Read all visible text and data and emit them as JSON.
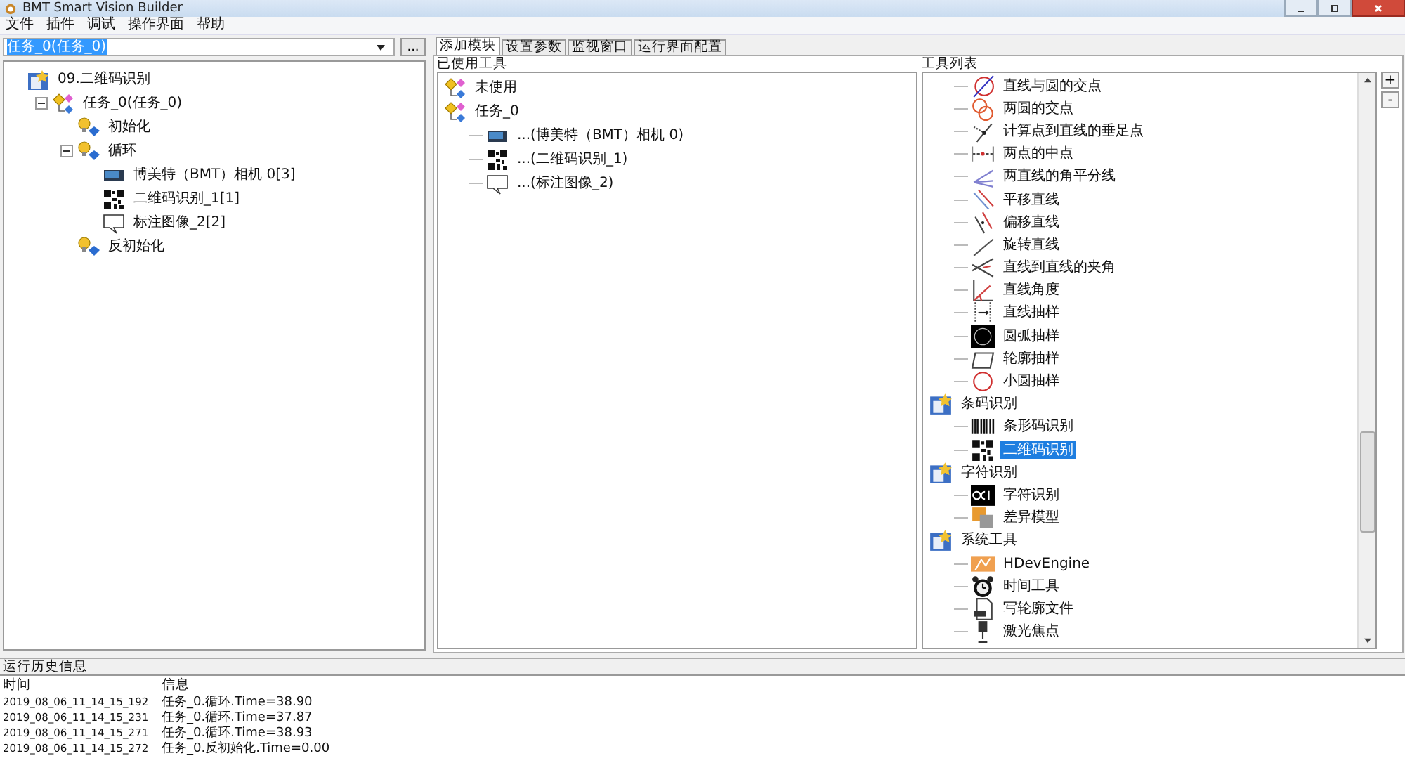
{
  "window": {
    "title": "BMT Smart Vision Builder"
  },
  "menu": [
    "文件",
    "插件",
    "调试",
    "操作界面",
    "帮助"
  ],
  "task_select": {
    "value": "任务_0(任务_0)",
    "button": "..."
  },
  "project_tree": [
    {
      "label": "09.二维码识别",
      "kind": "project",
      "children": [
        {
          "label": "任务_0(任务_0)",
          "kind": "task",
          "expanded": true,
          "children": [
            {
              "label": "初始化",
              "kind": "step"
            },
            {
              "label": "循环",
              "kind": "step",
              "expanded": true,
              "children": [
                {
                  "label": "博美特（BMT）相机 0[3]",
                  "kind": "camera"
                },
                {
                  "label": "二维码识别_1[1]",
                  "kind": "qrcode"
                },
                {
                  "label": "标注图像_2[2]",
                  "kind": "annotation"
                }
              ]
            },
            {
              "label": "反初始化",
              "kind": "step"
            }
          ]
        }
      ]
    }
  ],
  "tabs": [
    {
      "label": "添加模块",
      "selected": true
    },
    {
      "label": "设置参数",
      "selected": false
    },
    {
      "label": "监视窗口",
      "selected": false
    },
    {
      "label": "运行界面配置",
      "selected": false
    }
  ],
  "used_tools": {
    "title": "已使用工具",
    "tree": [
      {
        "label": "未使用",
        "kind": "task"
      },
      {
        "label": "任务_0",
        "kind": "task",
        "children": [
          {
            "label": "...(博美特（BMT）相机 0)",
            "kind": "camera"
          },
          {
            "label": "...(二维码识别_1)",
            "kind": "qrcode"
          },
          {
            "label": "...(标注图像_2)",
            "kind": "annotation"
          }
        ]
      }
    ]
  },
  "tool_list": {
    "title": "工具列表",
    "items": [
      {
        "kind": "tool",
        "label": "直线与圆的交点",
        "selected": false
      },
      {
        "kind": "tool",
        "label": "两圆的交点",
        "selected": false
      },
      {
        "kind": "tool",
        "label": "计算点到直线的垂足点",
        "selected": false
      },
      {
        "kind": "tool",
        "label": "两点的中点",
        "selected": false
      },
      {
        "kind": "tool",
        "label": "两直线的角平分线",
        "selected": false
      },
      {
        "kind": "tool",
        "label": "平移直线",
        "selected": false
      },
      {
        "kind": "tool",
        "label": "偏移直线",
        "selected": false
      },
      {
        "kind": "tool",
        "label": "旋转直线",
        "selected": false
      },
      {
        "kind": "tool",
        "label": "直线到直线的夹角",
        "selected": false
      },
      {
        "kind": "tool",
        "label": "直线角度",
        "selected": false
      },
      {
        "kind": "tool",
        "label": "直线抽样",
        "selected": false
      },
      {
        "kind": "tool",
        "label": "圆弧抽样",
        "selected": false
      },
      {
        "kind": "tool",
        "label": "轮廓抽样",
        "selected": false
      },
      {
        "kind": "tool",
        "label": "小圆抽样",
        "selected": false
      },
      {
        "kind": "group",
        "label": "条码识别",
        "selected": false,
        "children": [
          {
            "kind": "tool",
            "label": "条形码识别",
            "selected": false
          },
          {
            "kind": "tool",
            "label": "二维码识别",
            "selected": true
          }
        ]
      },
      {
        "kind": "group",
        "label": "字符识别",
        "selected": false,
        "children": [
          {
            "kind": "tool",
            "label": "字符识别",
            "selected": false
          },
          {
            "kind": "tool",
            "label": "差异模型",
            "selected": false
          }
        ]
      },
      {
        "kind": "group",
        "label": "系统工具",
        "selected": false,
        "children": [
          {
            "kind": "tool",
            "label": "HDevEngine",
            "selected": false
          },
          {
            "kind": "tool",
            "label": "时间工具",
            "selected": false
          },
          {
            "kind": "tool",
            "label": "写轮廓文件",
            "selected": false
          },
          {
            "kind": "tool",
            "label": "激光焦点",
            "selected": false
          }
        ]
      }
    ],
    "zoom_in": "+",
    "zoom_out": "-"
  },
  "log": {
    "title": "运行历史信息",
    "columns": [
      "时间",
      "信息"
    ],
    "rows": [
      [
        "2019_08_06_11_14_15_192",
        "任务_0.循环.Time=38.90"
      ],
      [
        "2019_08_06_11_14_15_231",
        "任务_0.循环.Time=37.87"
      ],
      [
        "2019_08_06_11_14_15_271",
        "任务_0.循环.Time=38.93"
      ],
      [
        "2019_08_06_11_14_15_272",
        "任务_0.反初始化.Time=0.00"
      ]
    ]
  }
}
